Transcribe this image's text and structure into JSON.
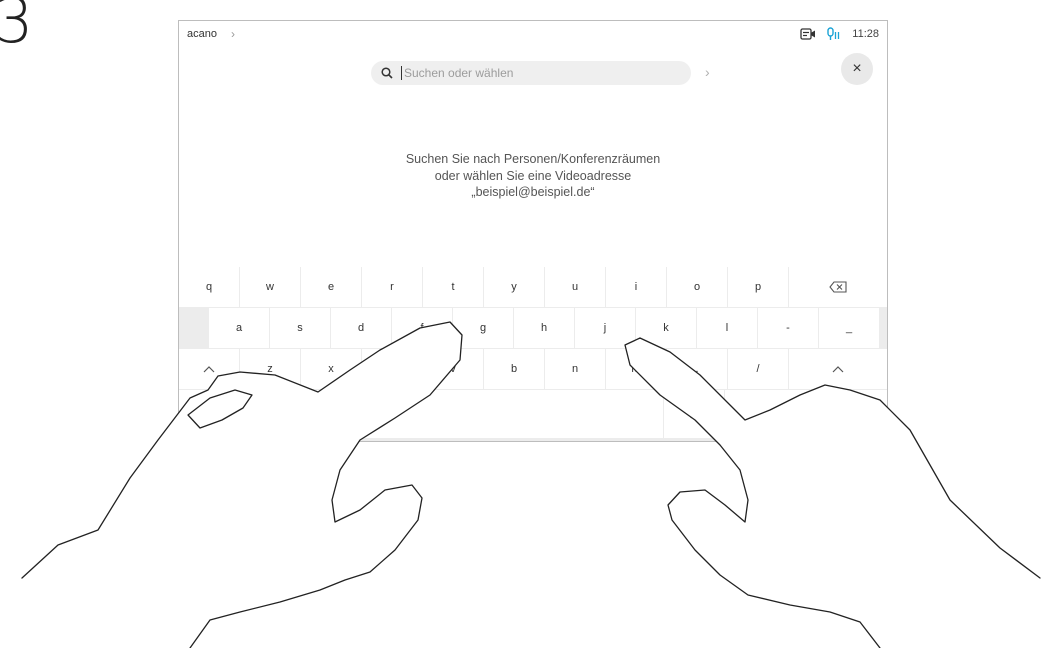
{
  "step": "3",
  "status": {
    "room": "acano",
    "time": "11:28",
    "icons": [
      "chevron-right-icon",
      "camera-icon",
      "microphone-icon"
    ]
  },
  "search": {
    "placeholder": "Suchen oder wählen",
    "icon": "search-icon",
    "go_icon": "chevron-right-icon"
  },
  "close": {
    "icon": "close-icon",
    "label": "×"
  },
  "instructions": [
    "Suchen Sie nach Personen/Konferenzräumen",
    "oder wählen Sie eine Videoadresse",
    "„beispiel@beispiel.de“"
  ],
  "keyboard": {
    "row1": [
      "q",
      "w",
      "e",
      "r",
      "t",
      "y",
      "u",
      "i",
      "o",
      "p"
    ],
    "row2": [
      "a",
      "s",
      "d",
      "f",
      "g",
      "h",
      "j",
      "k",
      "l",
      "-",
      "_"
    ],
    "row3": [
      "z",
      "x",
      "c",
      "v",
      "b",
      "n",
      "m",
      ".",
      "/"
    ],
    "at": "@",
    "backspace_icon": "backspace-icon",
    "shift_icon": "shift-icon"
  },
  "colors": {
    "background": "#ffffff",
    "keyboard_background": "#ececec",
    "search_field": "#efefef",
    "text": "#333333"
  }
}
